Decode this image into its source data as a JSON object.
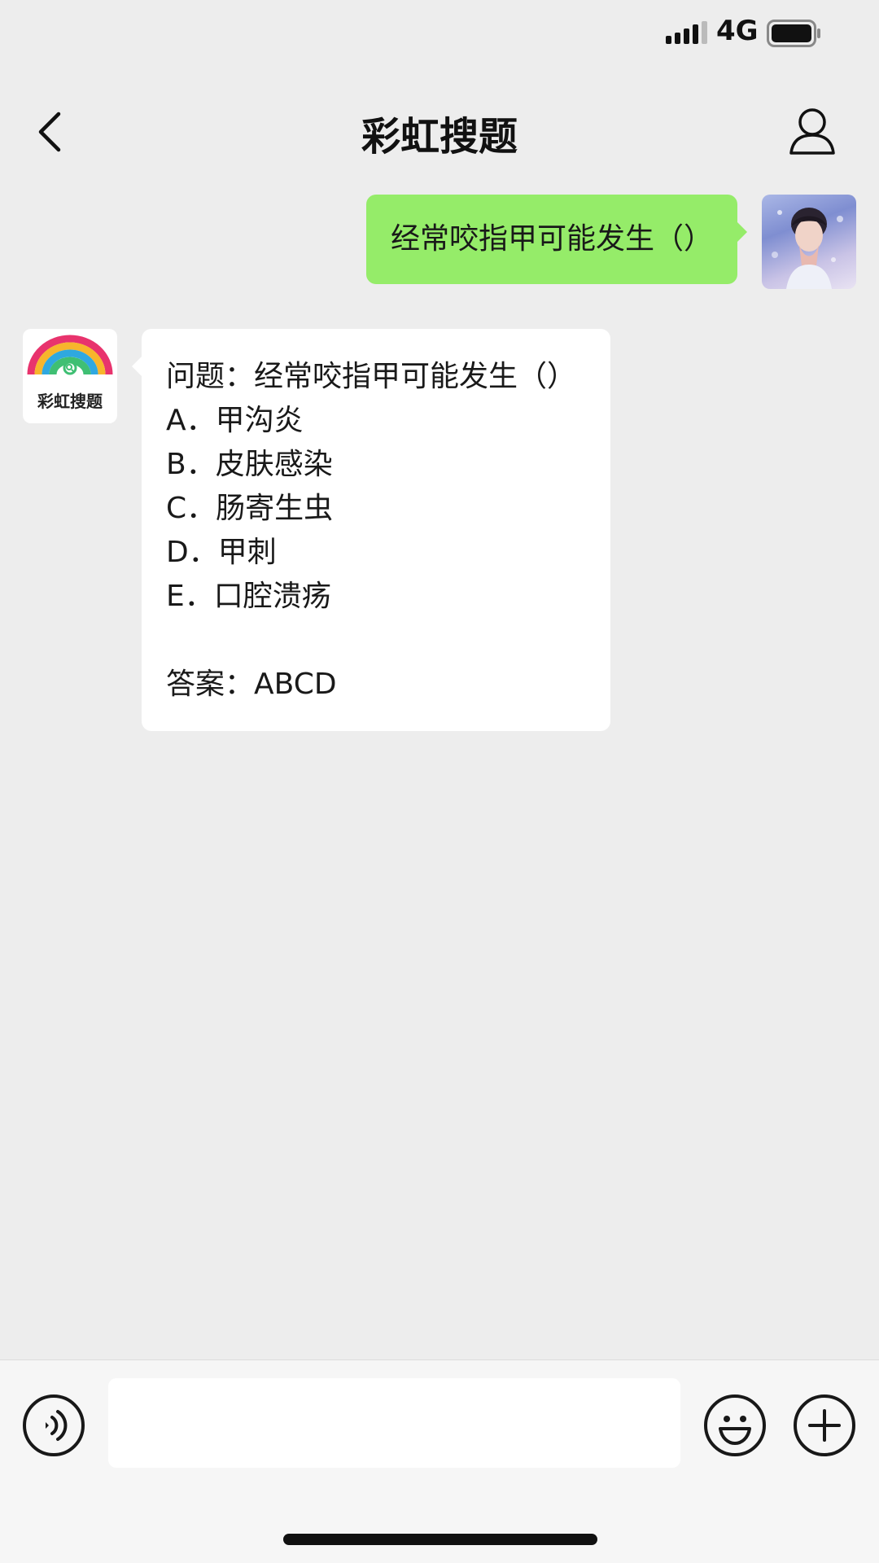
{
  "status_bar": {
    "network": "4G",
    "icons": [
      "signal-icon",
      "battery-icon"
    ]
  },
  "nav": {
    "title": "彩虹搜题",
    "back_icon": "chevron-left-icon",
    "profile_icon": "person-icon"
  },
  "messages": {
    "outgoing": {
      "text": "经常咬指甲可能发生（）",
      "avatar": "user-avatar"
    },
    "incoming": {
      "avatar_label": "彩虹搜题",
      "question": "问题：经常咬指甲可能发生（）",
      "options": [
        "A．甲沟炎",
        "B．皮肤感染",
        "C．肠寄生虫",
        "D．甲刺",
        "E．口腔溃疡"
      ],
      "answer": "答案：ABCD"
    }
  },
  "input_bar": {
    "input_value": "",
    "icons": [
      "voice-icon",
      "emoji-icon",
      "plus-icon"
    ]
  },
  "colors": {
    "background": "#ededed",
    "outgoing_bubble": "#95ec69",
    "incoming_bubble": "#ffffff",
    "input_bar": "#f6f6f6"
  }
}
